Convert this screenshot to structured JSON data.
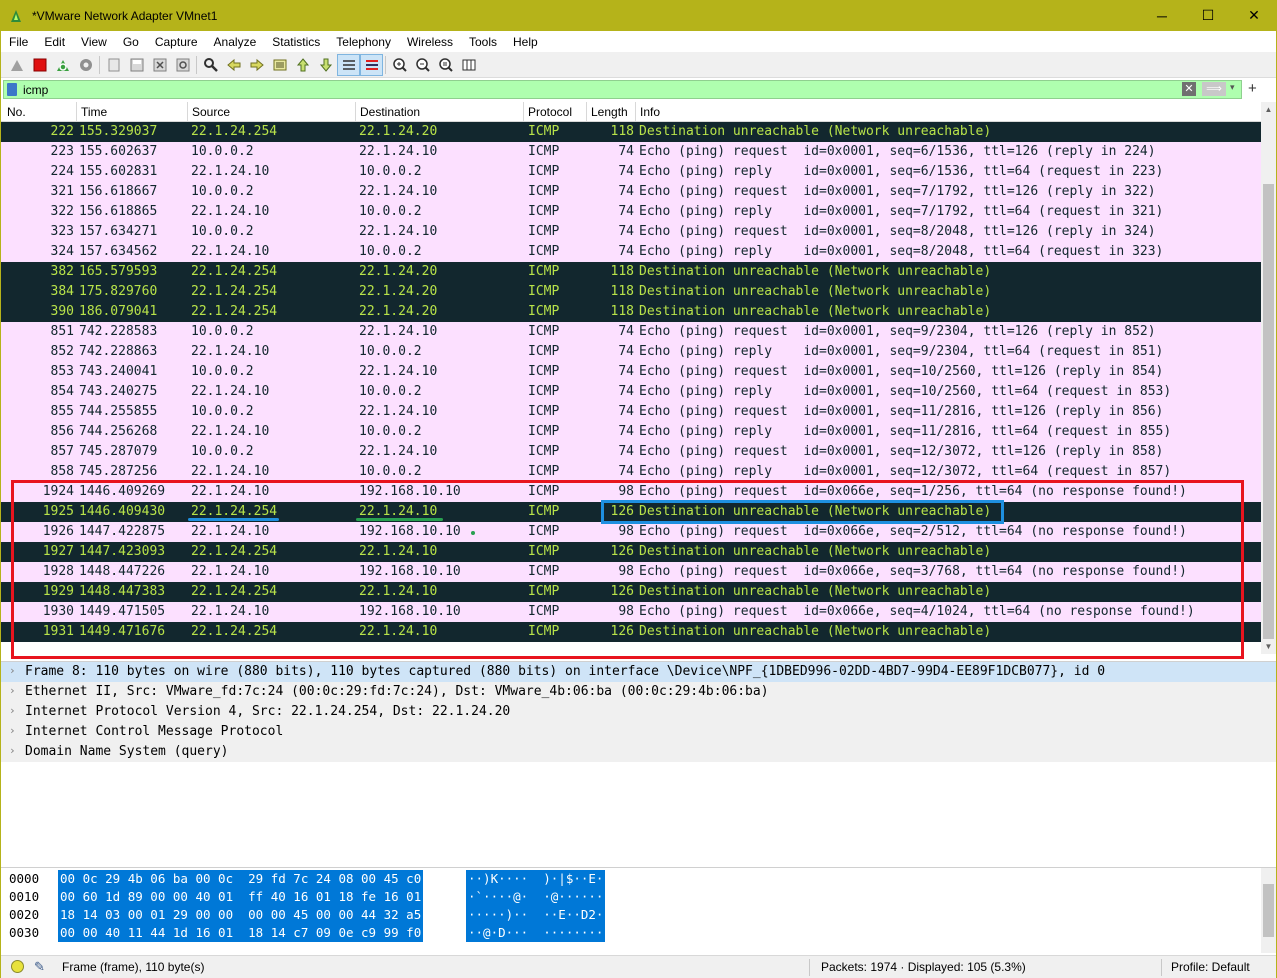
{
  "window": {
    "title": "*VMware Network Adapter VMnet1",
    "minimize": "─",
    "maximize": "☐",
    "close": "✕"
  },
  "menu": [
    "File",
    "Edit",
    "View",
    "Go",
    "Capture",
    "Analyze",
    "Statistics",
    "Telephony",
    "Wireless",
    "Tools",
    "Help"
  ],
  "toolbar": {
    "icons": [
      "shark-start-icon",
      "stop-icon",
      "restart-icon",
      "options-icon",
      "open-icon",
      "save-icon",
      "close-file-icon",
      "reload-icon",
      "find-icon",
      "go-back-icon",
      "go-forward-icon",
      "go-to-packet-icon",
      "go-first-icon",
      "go-last-icon",
      "autoscroll-icon",
      "colorize-icon",
      "zoom-in-icon",
      "zoom-out-icon",
      "zoom-normal-icon",
      "resize-columns-icon"
    ]
  },
  "filter": {
    "value": "icmp",
    "clear": "✕",
    "apply": "⟹",
    "dropdown": "▾",
    "add": "+"
  },
  "columns": [
    "No.",
    "Time",
    "Source",
    "Destination",
    "Protocol",
    "Length",
    "Info"
  ],
  "packets": [
    {
      "no": "222",
      "time": "155.329037",
      "src": "22.1.24.254",
      "dst": "22.1.24.20",
      "proto": "ICMP",
      "len": "118",
      "info": "Destination unreachable (Network unreachable)",
      "style": "bad2"
    },
    {
      "no": "223",
      "time": "155.602637",
      "src": "10.0.0.2",
      "dst": "22.1.24.10",
      "proto": "ICMP",
      "len": "74",
      "info": "Echo (ping) request  id=0x0001, seq=6/1536, ttl=126 (reply in 224)",
      "style": "normal"
    },
    {
      "no": "224",
      "time": "155.602831",
      "src": "22.1.24.10",
      "dst": "10.0.0.2",
      "proto": "ICMP",
      "len": "74",
      "info": "Echo (ping) reply    id=0x0001, seq=6/1536, ttl=64 (request in 223)",
      "style": "normal"
    },
    {
      "no": "321",
      "time": "156.618667",
      "src": "10.0.0.2",
      "dst": "22.1.24.10",
      "proto": "ICMP",
      "len": "74",
      "info": "Echo (ping) request  id=0x0001, seq=7/1792, ttl=126 (reply in 322)",
      "style": "normal"
    },
    {
      "no": "322",
      "time": "156.618865",
      "src": "22.1.24.10",
      "dst": "10.0.0.2",
      "proto": "ICMP",
      "len": "74",
      "info": "Echo (ping) reply    id=0x0001, seq=7/1792, ttl=64 (request in 321)",
      "style": "normal"
    },
    {
      "no": "323",
      "time": "157.634271",
      "src": "10.0.0.2",
      "dst": "22.1.24.10",
      "proto": "ICMP",
      "len": "74",
      "info": "Echo (ping) request  id=0x0001, seq=8/2048, ttl=126 (reply in 324)",
      "style": "normal"
    },
    {
      "no": "324",
      "time": "157.634562",
      "src": "22.1.24.10",
      "dst": "10.0.0.2",
      "proto": "ICMP",
      "len": "74",
      "info": "Echo (ping) reply    id=0x0001, seq=8/2048, ttl=64 (request in 323)",
      "style": "normal"
    },
    {
      "no": "382",
      "time": "165.579593",
      "src": "22.1.24.254",
      "dst": "22.1.24.20",
      "proto": "ICMP",
      "len": "118",
      "info": "Destination unreachable (Network unreachable)",
      "style": "bad2"
    },
    {
      "no": "384",
      "time": "175.829760",
      "src": "22.1.24.254",
      "dst": "22.1.24.20",
      "proto": "ICMP",
      "len": "118",
      "info": "Destination unreachable (Network unreachable)",
      "style": "bad2"
    },
    {
      "no": "390",
      "time": "186.079041",
      "src": "22.1.24.254",
      "dst": "22.1.24.20",
      "proto": "ICMP",
      "len": "118",
      "info": "Destination unreachable (Network unreachable)",
      "style": "bad2"
    },
    {
      "no": "851",
      "time": "742.228583",
      "src": "10.0.0.2",
      "dst": "22.1.24.10",
      "proto": "ICMP",
      "len": "74",
      "info": "Echo (ping) request  id=0x0001, seq=9/2304, ttl=126 (reply in 852)",
      "style": "normal"
    },
    {
      "no": "852",
      "time": "742.228863",
      "src": "22.1.24.10",
      "dst": "10.0.0.2",
      "proto": "ICMP",
      "len": "74",
      "info": "Echo (ping) reply    id=0x0001, seq=9/2304, ttl=64 (request in 851)",
      "style": "normal"
    },
    {
      "no": "853",
      "time": "743.240041",
      "src": "10.0.0.2",
      "dst": "22.1.24.10",
      "proto": "ICMP",
      "len": "74",
      "info": "Echo (ping) request  id=0x0001, seq=10/2560, ttl=126 (reply in 854)",
      "style": "normal"
    },
    {
      "no": "854",
      "time": "743.240275",
      "src": "22.1.24.10",
      "dst": "10.0.0.2",
      "proto": "ICMP",
      "len": "74",
      "info": "Echo (ping) reply    id=0x0001, seq=10/2560, ttl=64 (request in 853)",
      "style": "normal"
    },
    {
      "no": "855",
      "time": "744.255855",
      "src": "10.0.0.2",
      "dst": "22.1.24.10",
      "proto": "ICMP",
      "len": "74",
      "info": "Echo (ping) request  id=0x0001, seq=11/2816, ttl=126 (reply in 856)",
      "style": "normal"
    },
    {
      "no": "856",
      "time": "744.256268",
      "src": "22.1.24.10",
      "dst": "10.0.0.2",
      "proto": "ICMP",
      "len": "74",
      "info": "Echo (ping) reply    id=0x0001, seq=11/2816, ttl=64 (request in 855)",
      "style": "normal"
    },
    {
      "no": "857",
      "time": "745.287079",
      "src": "10.0.0.2",
      "dst": "22.1.24.10",
      "proto": "ICMP",
      "len": "74",
      "info": "Echo (ping) request  id=0x0001, seq=12/3072, ttl=126 (reply in 858)",
      "style": "normal"
    },
    {
      "no": "858",
      "time": "745.287256",
      "src": "22.1.24.10",
      "dst": "10.0.0.2",
      "proto": "ICMP",
      "len": "74",
      "info": "Echo (ping) reply    id=0x0001, seq=12/3072, ttl=64 (request in 857)",
      "style": "normal"
    },
    {
      "no": "1924",
      "time": "1446.409269",
      "src": "22.1.24.10",
      "dst": "192.168.10.10",
      "proto": "ICMP",
      "len": "98",
      "info": "Echo (ping) request  id=0x066e, seq=1/256, ttl=64 (no response found!)",
      "style": "normal"
    },
    {
      "no": "1925",
      "time": "1446.409430",
      "src": "22.1.24.254",
      "dst": "22.1.24.10",
      "proto": "ICMP",
      "len": "126",
      "info": "Destination unreachable (Network unreachable)",
      "style": "bad2"
    },
    {
      "no": "1926",
      "time": "1447.422875",
      "src": "22.1.24.10",
      "dst": "192.168.10.10",
      "proto": "ICMP",
      "len": "98",
      "info": "Echo (ping) request  id=0x066e, seq=2/512, ttl=64 (no response found!)",
      "style": "normal"
    },
    {
      "no": "1927",
      "time": "1447.423093",
      "src": "22.1.24.254",
      "dst": "22.1.24.10",
      "proto": "ICMP",
      "len": "126",
      "info": "Destination unreachable (Network unreachable)",
      "style": "bad2"
    },
    {
      "no": "1928",
      "time": "1448.447226",
      "src": "22.1.24.10",
      "dst": "192.168.10.10",
      "proto": "ICMP",
      "len": "98",
      "info": "Echo (ping) request  id=0x066e, seq=3/768, ttl=64 (no response found!)",
      "style": "normal"
    },
    {
      "no": "1929",
      "time": "1448.447383",
      "src": "22.1.24.254",
      "dst": "22.1.24.10",
      "proto": "ICMP",
      "len": "126",
      "info": "Destination unreachable (Network unreachable)",
      "style": "bad2"
    },
    {
      "no": "1930",
      "time": "1449.471505",
      "src": "22.1.24.10",
      "dst": "192.168.10.10",
      "proto": "ICMP",
      "len": "98",
      "info": "Echo (ping) request  id=0x066e, seq=4/1024, ttl=64 (no response found!)",
      "style": "normal"
    },
    {
      "no": "1931",
      "time": "1449.471676",
      "src": "22.1.24.254",
      "dst": "22.1.24.10",
      "proto": "ICMP",
      "len": "126",
      "info": "Destination unreachable (Network unreachable)",
      "style": "bad2"
    }
  ],
  "details": [
    "Frame 8: 110 bytes on wire (880 bits), 110 bytes captured (880 bits) on interface \\Device\\NPF_{1DBED996-02DD-4BD7-99D4-EE89F1DCB077}, id 0",
    "Ethernet II, Src: VMware_fd:7c:24 (00:0c:29:fd:7c:24), Dst: VMware_4b:06:ba (00:0c:29:4b:06:ba)",
    "Internet Protocol Version 4, Src: 22.1.24.254, Dst: 22.1.24.20",
    "Internet Control Message Protocol",
    "Domain Name System (query)"
  ],
  "bytes": [
    {
      "offset": "0000",
      "hex": "00 0c 29 4b 06 ba 00 0c  29 fd 7c 24 08 00 45 c0",
      "ascii": "··)K····  )·|$··E·"
    },
    {
      "offset": "0010",
      "hex": "00 60 1d 89 00 00 40 01  ff 40 16 01 18 fe 16 01",
      "ascii": "·`····@·  ·@······"
    },
    {
      "offset": "0020",
      "hex": "18 14 03 00 01 29 00 00  00 00 45 00 00 44 32 a5",
      "ascii": "·····)··  ··E··D2·"
    },
    {
      "offset": "0030",
      "hex": "00 00 40 11 44 1d 16 01  18 14 c7 09 0e c9 99 f0",
      "ascii": "··@·D···  ········"
    }
  ],
  "status": {
    "field": "Frame (frame), 110 byte(s)",
    "packets": "Packets: 1974 · Displayed: 105 (5.3%)",
    "profile": "Profile: Default"
  },
  "colors": {
    "titlebar": "#b5b31a",
    "row_normal_bg": "#fce0ff",
    "row_error_bg": "#12272e",
    "row_error_fg": "#b8e34a",
    "filter_bg": "#afffaf",
    "annotation_red": "#e8141e",
    "annotation_blue": "#1e90e0",
    "annotation_green": "#28a050"
  }
}
